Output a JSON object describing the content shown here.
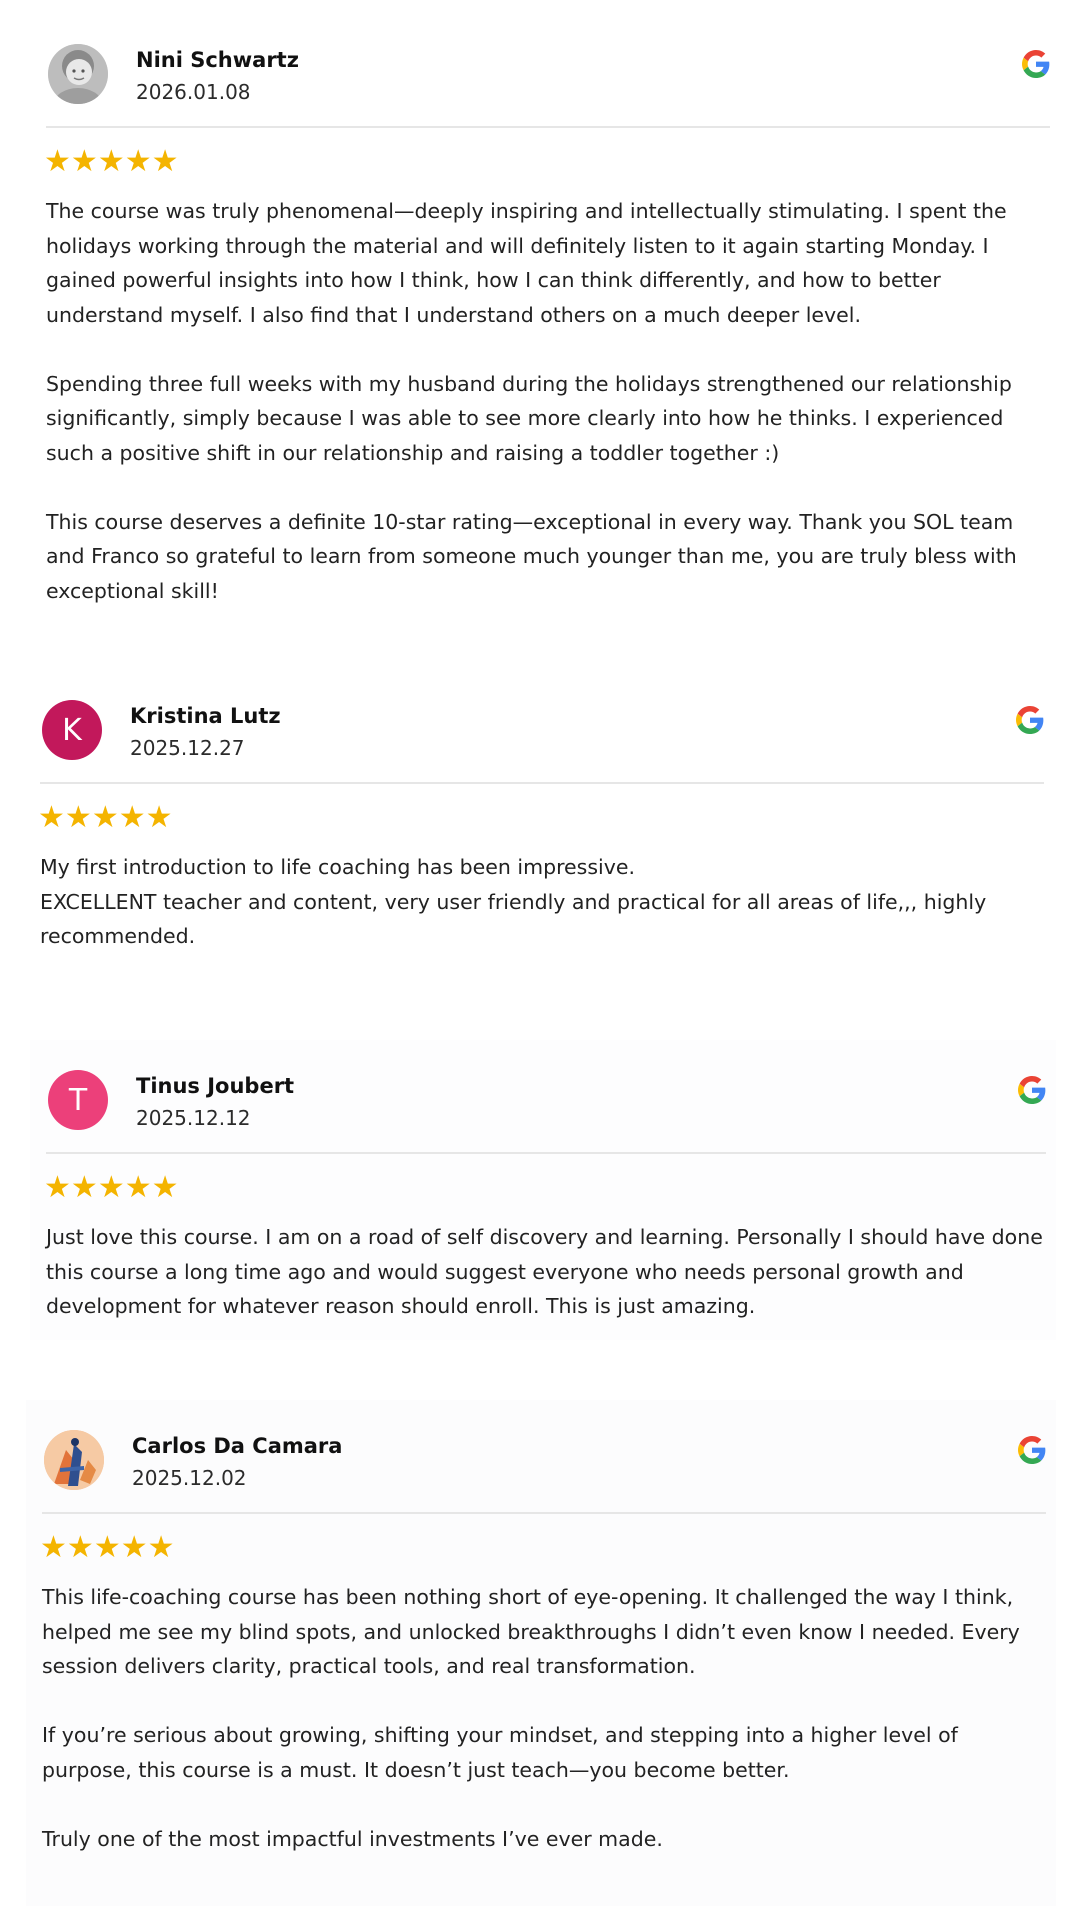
{
  "reviews": [
    {
      "name": "Nini Schwartz",
      "date": "2026.01.08",
      "avatar": {
        "kind": "photo",
        "icon": "person-photo-avatar",
        "color": "#cfcfcf"
      },
      "stars": 5,
      "source_icon": "google-g-icon",
      "paragraphs": [
        "The course was truly phenomenal—deeply inspiring and intellectually stimulating. I spent the holidays working through the material and will definitely listen to it again starting Monday. I gained powerful insights into how I think, how I can think differently, and how to better understand myself. I also find that I understand others on a much deeper level.",
        "Spending three full weeks with my husband during the holidays strengthened our relationship significantly, simply because I was able to see more clearly into how he thinks. I experienced such a positive shift in our relationship and raising a toddler together :)",
        "This course deserves a definite 10-star rating—exceptional in every way. Thank you SOL team and Franco so grateful to learn from someone much younger than me, you are truly bless with exceptional skill!"
      ]
    },
    {
      "name": "Kristina Lutz",
      "date": "2025.12.27",
      "avatar": {
        "kind": "initial",
        "letter": "K",
        "color": "#c2185b"
      },
      "stars": 5,
      "source_icon": "google-g-icon",
      "paragraphs": [
        "My first introduction to life coaching has been impressive.\nEXCELLENT teacher and content, very user friendly and practical for all areas of life,,, highly recommended."
      ]
    },
    {
      "name": "Tinus Joubert",
      "date": "2025.12.12",
      "avatar": {
        "kind": "initial",
        "letter": "T",
        "color": "#ec407a"
      },
      "stars": 5,
      "source_icon": "google-g-icon",
      "paragraphs": [
        "Just love this course. I am on a road of self discovery and learning. Personally I should have done this course a long time ago and would suggest everyone who needs personal growth and development for whatever reason should enroll. This is just amazing."
      ]
    },
    {
      "name": "Carlos Da Camara",
      "date": "2025.12.02",
      "avatar": {
        "kind": "photo",
        "icon": "illustrated-avatar",
        "color": "#f4c19a"
      },
      "stars": 5,
      "source_icon": "google-g-icon",
      "paragraphs": [
        "This life-coaching course has been nothing short of eye-opening. It challenged the way I think, helped me see my blind spots, and unlocked breakthroughs I didn’t even know I needed. Every session delivers clarity, practical tools, and real transformation.",
        "If you’re serious about growing, shifting your mindset, and stepping into a higher level of purpose, this course is a must. It doesn’t just teach—you become better.",
        "Truly one of the most impactful investments I’ve ever made."
      ]
    }
  ],
  "colors": {
    "star": "#f4b400",
    "divider": "#e6e6e6",
    "text": "#222222"
  }
}
